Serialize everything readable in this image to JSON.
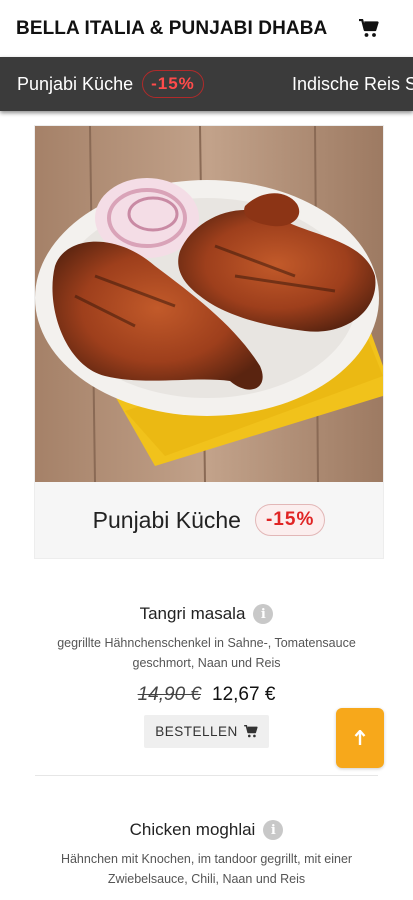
{
  "header": {
    "brand": "BELLA ITALIA & PUNJABI DHABA",
    "cart_icon": "cart-icon"
  },
  "categories": [
    {
      "label": "Punjabi Küche",
      "badge": "-15%"
    },
    {
      "label": "Indische Reis S"
    }
  ],
  "hero": {
    "title": "Punjabi Küche",
    "badge": "-15%"
  },
  "items": [
    {
      "name": "Tangri masala",
      "description": "gegrillte Hähnchenschenkel in Sahne-, Tomatensauce geschmort, Naan und Reis",
      "old_price": "14,90 €",
      "new_price": "12,67 €",
      "order_label": "BESTELLEN"
    },
    {
      "name": "Chicken moghlai",
      "description": "Hähnchen mit Knochen, im tandoor gegrillt, mit einer Zwiebelsauce, Chili, Naan und Reis"
    }
  ],
  "colors": {
    "accent": "#f7a81b",
    "discount": "#e02424",
    "category_bar": "#3b3b3b"
  }
}
